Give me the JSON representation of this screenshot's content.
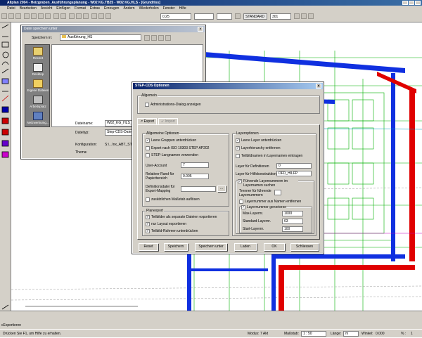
{
  "window": {
    "title": "Allplan 2004 - Heizgraben_Ausführungsplanung - W02 KG.TB25 - W02 KG.HLS - [Grundriss]"
  },
  "menu": [
    "Datei",
    "Bearbeiten",
    "Ansicht",
    "Einfügen",
    "Format",
    "Extras",
    "Erzeugen",
    "Ändern",
    "Wiederholen",
    "Fenster",
    "Hilfe"
  ],
  "toolbar": {
    "pen": "0.25",
    "layer": "STANDARD",
    "scale": "301"
  },
  "save_dialog": {
    "title": "Datei speichern unter",
    "save_in_label": "Speichern in:",
    "save_in_value": "Ausführung_HS",
    "places": [
      "Recent",
      "Desktop",
      "Eigene Dateien",
      "Arbeitsplatz",
      "Netzwerkumg..."
    ],
    "filename_label": "Dateiname:",
    "filename_value": "W02_KG_HLS_TB25.stp",
    "filetype_label": "Dateityp:",
    "filetype_value": "Step-CDS-Dateien (*.stp)",
    "config_label": "Konfiguration:",
    "config_value": "S:\\...\\nx_ABT_STEP_CDS",
    "theme_label": "Thema:"
  },
  "step_dialog": {
    "title": "STEP-CDS Optionen",
    "general_group": "Allgemein",
    "admin_dialog": "Administrations-Dialog anzeigen",
    "tabs": [
      "Export",
      "Import"
    ],
    "general_options_group": "Allgemeine Optionen",
    "opt_empty_groups": "Leere Gruppen unterdrücken",
    "opt_iso": "Export nach ISO 10303 STEP AP202",
    "opt_long_names": "STEP-Langnamen verwenden",
    "user_account_label": "User-Account",
    "user_account_value": "7",
    "margin_label": "Relativer Rand für Papierbereich",
    "margin_value": "0.005",
    "defs_label": "Definitionsdatei für Export-Mapping",
    "opt_scale": "zusätzlichen Maßstab auflösen",
    "plan_group": "Planexport",
    "opt_separate": "Teilbilder als separate Dateien exportieren",
    "opt_layout": "nur Layout exportieren",
    "opt_frame": "Teilbild-Rahmen unterdrücken",
    "layer_group": "Layeroptionen",
    "opt_empty_layers": "Leere Layer unterdrücken",
    "opt_hierarchy": "Layerhierarchy entfernen",
    "opt_sublayers": "Teilbildnamen in Layernamen eintragen",
    "defs_layer_label": "Layer für Definitionen",
    "defs_layer_value": "0",
    "aux_layer_label": "Layer für Hilfskonstruktionen",
    "aux_layer_value": "DFD_HILFP",
    "leading_layers": "Führende Layernummern im Layernamen suchen",
    "separator_label": "Trenner für führende Layernummern",
    "opt_remove_numbers": "Layernummer aus Namen entfernen",
    "opt_generate": "Layernummer generieren",
    "max_layer_label": "Max-Layernr.",
    "max_layer_value": "1000",
    "std_layer_label": "Standard-Layernr.",
    "std_layer_value": "63",
    "start_layer_label": "Start-Layernr.",
    "start_layer_value": "100",
    "buttons": [
      "Reset",
      "Speichern",
      "Speichern unter",
      "Laden",
      "OK",
      "Schliessen"
    ]
  },
  "status": {
    "tab": "cExportieren",
    "hint": "Drücken Sie F1, um Hilfe zu erhalten.",
    "mode_label": "Modus:",
    "mode_value": "7 Akt",
    "scale_label": "Maßstab:",
    "scale_value": "1 : 50",
    "length_label": "Länge:",
    "length_value": "m",
    "angle_label": "Winkel:",
    "angle_value": "0.000",
    "percent_label": "% :",
    "percent_value": "1"
  }
}
